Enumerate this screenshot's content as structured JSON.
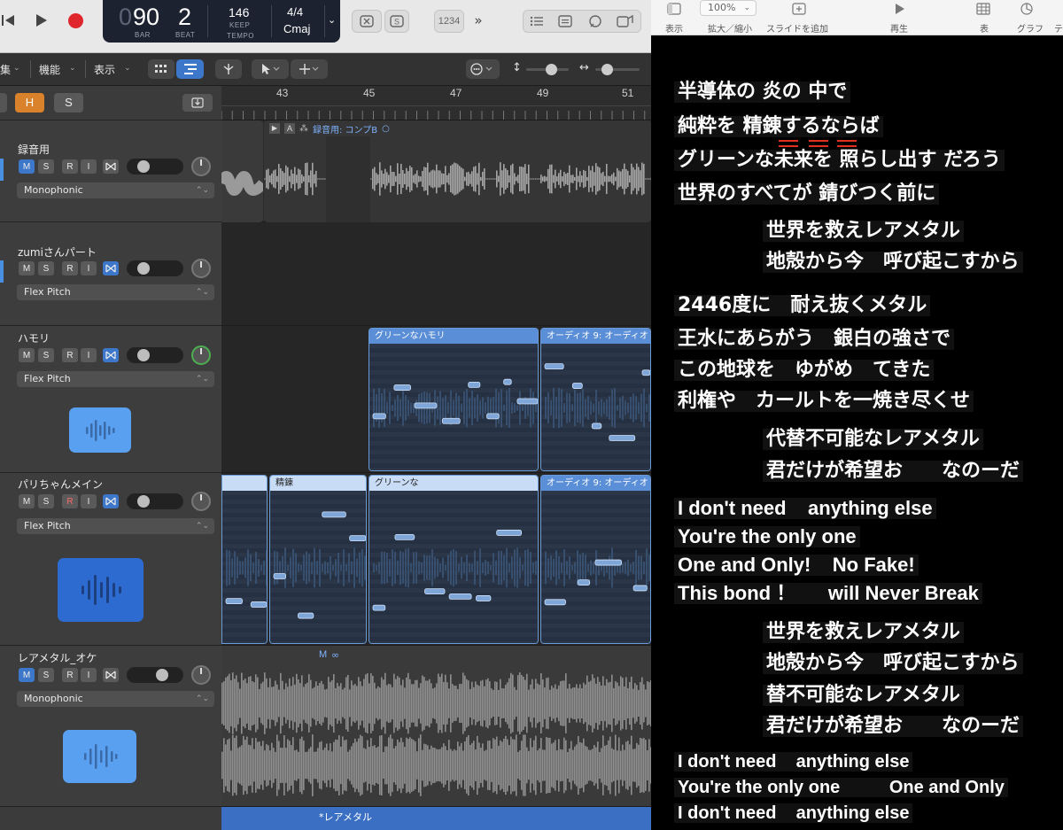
{
  "transport": {
    "bar_prefix": "0",
    "bar": "90",
    "beat": "2",
    "bar_label": "BAR",
    "beat_label": "BEAT",
    "tempo": "146",
    "tempo_mode": "KEEP",
    "tempo_label": "TEMPO",
    "time_signature": "4/4",
    "key": "Cmaj",
    "count_in": "1234"
  },
  "menubar": {
    "edit": "集",
    "function": "機能",
    "view": "表示"
  },
  "header_buttons": {
    "hide": "H",
    "solo": "S"
  },
  "tracks": [
    {
      "name": "録音用",
      "mode": "Monophonic"
    },
    {
      "name": "zumiさんパート",
      "mode": "Flex Pitch"
    },
    {
      "name": "ハモリ",
      "mode": "Flex Pitch"
    },
    {
      "name": "パリちゃんメイン",
      "mode": "Flex Pitch"
    },
    {
      "name": "レアメタル_オケ",
      "mode": "Monophonic"
    }
  ],
  "track_buttons": {
    "mute": "M",
    "solo": "S",
    "record": "R",
    "input": "I"
  },
  "ruler": {
    "bars": [
      "43",
      "45",
      "47",
      "49",
      "51"
    ]
  },
  "regions": {
    "take_folder": "録音用: コンプB",
    "take_a": "A",
    "harmony": "グリーンなハモリ",
    "audio9_top": "オーディオ 9: オーディオ",
    "seiren": "精錬",
    "green": "グリーンな",
    "audio9_bottom": "オーディオ 9: オーディオ",
    "orch_marker": "M",
    "bottom_region": "*レアメタル"
  },
  "keynote": {
    "zoom": "100%",
    "labels": {
      "view": "表示",
      "zoom": "拡大／縮小",
      "add_slide": "スライドを追加",
      "play": "再生",
      "table": "表",
      "chart": "グラフ",
      "text": "テ"
    }
  },
  "lyrics": [
    "半導体の 炎の 中で",
    "純粋を 精錬するならば",
    "グリーンな未来を 照らし出す だろう",
    "世界のすべてが 錆びつく前に",
    "世界を救えレアメタル",
    "地殻から今　呼び起こすから",
    "2446度に　耐え抜くメタル",
    "王水にあらがう　銀白の強さで",
    "この地球を　ゆがめ　てきた",
    "利権や　カールトを一焼き尽くせ",
    "代替不可能なレアメタル",
    "君だけが希望お　　なのーだ",
    "I don't need    anything else",
    "You're the only one",
    "One and Only!    No Fake!",
    "This bond ！      will Never Break",
    "世界を救えレアメタル",
    "地殻から今　呼び起こすから",
    "替不可能なレアメタル",
    "君だけが希望お　　なのーだ",
    "I don't need    anything else",
    "You're the only one          One and Only",
    "I don't need    anything else"
  ]
}
